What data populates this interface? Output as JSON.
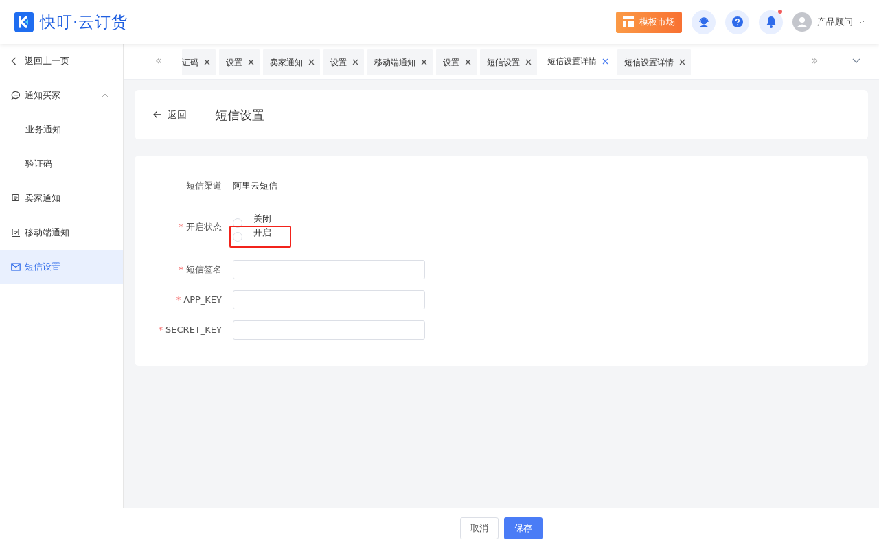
{
  "header": {
    "logo_text": "快叮·云订货",
    "template_button": "模板市场",
    "notification_dot": true,
    "user": "产品顾问"
  },
  "sidebar": {
    "back": "返回上一页",
    "items": [
      {
        "label": "通知买家",
        "kind": "chat",
        "expanded": true,
        "selected": false,
        "children": [
          {
            "label": "业务通知",
            "selected": false
          },
          {
            "label": "验证码",
            "selected": false
          }
        ]
      },
      {
        "label": "卖家通知",
        "kind": "note",
        "selected": false
      },
      {
        "label": "移动端通知",
        "kind": "note",
        "selected": false
      },
      {
        "label": "短信设置",
        "kind": "mail",
        "selected": true
      }
    ]
  },
  "tab_nav": {
    "prev": "«",
    "next": "»"
  },
  "tabs": [
    {
      "label": "证码",
      "selected": false
    },
    {
      "label": "设置",
      "selected": false
    },
    {
      "label": "卖家通知",
      "selected": false
    },
    {
      "label": "设置",
      "selected": false
    },
    {
      "label": "移动端通知",
      "selected": false
    },
    {
      "label": "设置",
      "selected": false
    },
    {
      "label": "短信设置",
      "selected": false
    },
    {
      "label": "短信设置详情",
      "selected": true
    },
    {
      "label": "短信设置详情",
      "selected": false
    }
  ],
  "page_header": {
    "back": "返回",
    "title": "短信设置"
  },
  "form": {
    "required_mark": "*",
    "fields": [
      {
        "kind": "text",
        "label": "短信渠道",
        "required": false,
        "value": "阿里云短信"
      },
      {
        "kind": "radio",
        "label": "开启状态",
        "required": true,
        "options": [
          {
            "label": "关闭",
            "selected": false,
            "highlighted": false
          },
          {
            "label": "开启",
            "selected": false,
            "highlighted": true
          }
        ]
      },
      {
        "kind": "input",
        "label": "短信签名",
        "required": true
      },
      {
        "kind": "input",
        "label": "APP_KEY",
        "required": true
      },
      {
        "kind": "input",
        "label": "SECRET_KEY",
        "required": true
      }
    ]
  },
  "footer": {
    "buttons": [
      {
        "label": "取消",
        "kind": "default"
      },
      {
        "label": "保存",
        "kind": "primary"
      }
    ]
  }
}
